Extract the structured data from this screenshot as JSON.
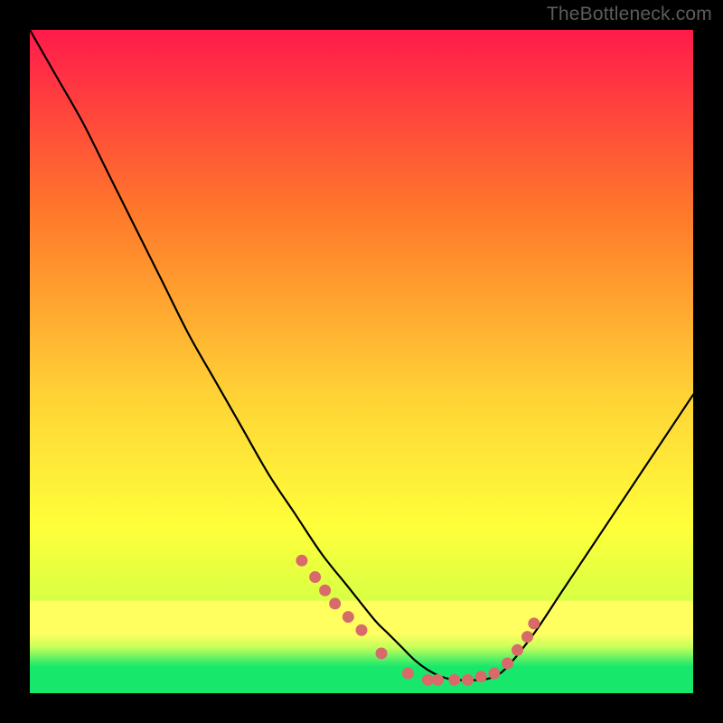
{
  "watermark": "TheBottleneck.com",
  "colors": {
    "background": "#000000",
    "gradient_top": "#ff1a4b",
    "gradient_upper_mid": "#ff7a2a",
    "gradient_mid": "#ffd236",
    "gradient_lower_mid": "#ffff3a",
    "gradient_low": "#d8ff44",
    "gradient_band_yellow": "#ffff60",
    "gradient_band_lime": "#c8ff5a",
    "gradient_bottom_green": "#17e86b",
    "curve": "#000000",
    "marker": "#d96a6a"
  },
  "chart_data": {
    "type": "line",
    "title": "",
    "xlabel": "",
    "ylabel": "",
    "xlim": [
      0,
      100
    ],
    "ylim": [
      0,
      100
    ],
    "curve": {
      "x": [
        0,
        4,
        8,
        12,
        16,
        20,
        24,
        28,
        32,
        36,
        40,
        44,
        48,
        52,
        54,
        56,
        58,
        60,
        62,
        64,
        66,
        68,
        70,
        72,
        76,
        80,
        84,
        88,
        92,
        96,
        100
      ],
      "y": [
        100,
        93,
        86,
        78,
        70,
        62,
        54,
        47,
        40,
        33,
        27,
        21,
        16,
        11,
        9,
        7,
        5,
        3.5,
        2.5,
        2,
        2,
        2,
        2.5,
        4,
        9,
        15,
        21,
        27,
        33,
        39,
        45
      ]
    },
    "markers": {
      "x": [
        41,
        43,
        44.5,
        46,
        48,
        50,
        53,
        57,
        60,
        61.5,
        64,
        66,
        68,
        70,
        72,
        73.5,
        75,
        76
      ],
      "y": [
        20,
        17.5,
        15.5,
        13.5,
        11.5,
        9.5,
        6,
        3,
        2,
        2,
        2,
        2,
        2.5,
        3,
        4.5,
        6.5,
        8.5,
        10.5
      ]
    }
  }
}
